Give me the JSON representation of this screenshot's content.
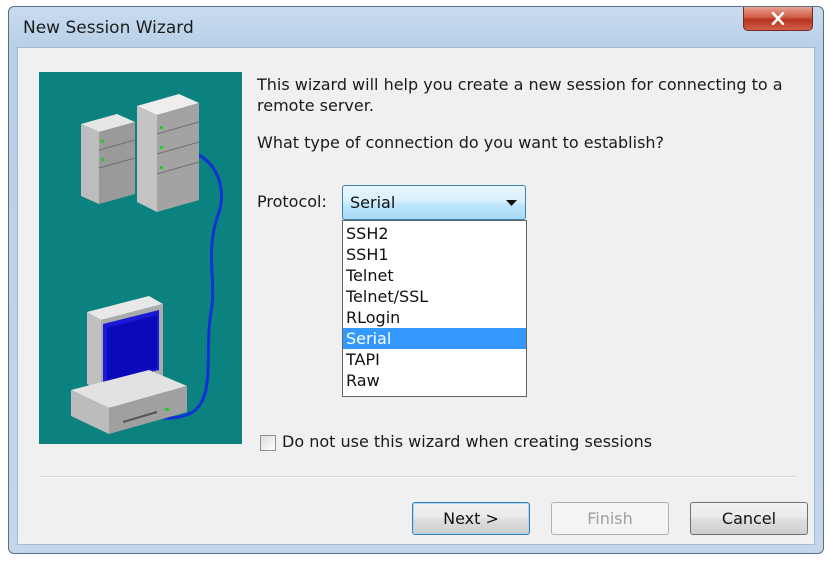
{
  "window": {
    "title": "New Session Wizard"
  },
  "icons": {
    "close": "close-icon",
    "illustration": "server-computer-network-illustration",
    "dropdown": "chevron-down-icon"
  },
  "intro": {
    "line1": "This wizard will help you create a new session for connecting to a",
    "line2": "remote server.",
    "question": "What type of connection do you want to establish?"
  },
  "protocol": {
    "label": "Protocol:",
    "selected": "Serial",
    "options": [
      "SSH2",
      "SSH1",
      "Telnet",
      "Telnet/SSL",
      "RLogin",
      "Serial",
      "TAPI",
      "Raw"
    ]
  },
  "checkbox": {
    "label": "Do not use this wizard when creating sessions",
    "checked": false
  },
  "buttons": {
    "next": "Next >",
    "finish": "Finish",
    "cancel": "Cancel"
  },
  "colors": {
    "illustration_bg": "#0c8280",
    "selection": "#3399ff",
    "close_red": "#c8432c"
  }
}
